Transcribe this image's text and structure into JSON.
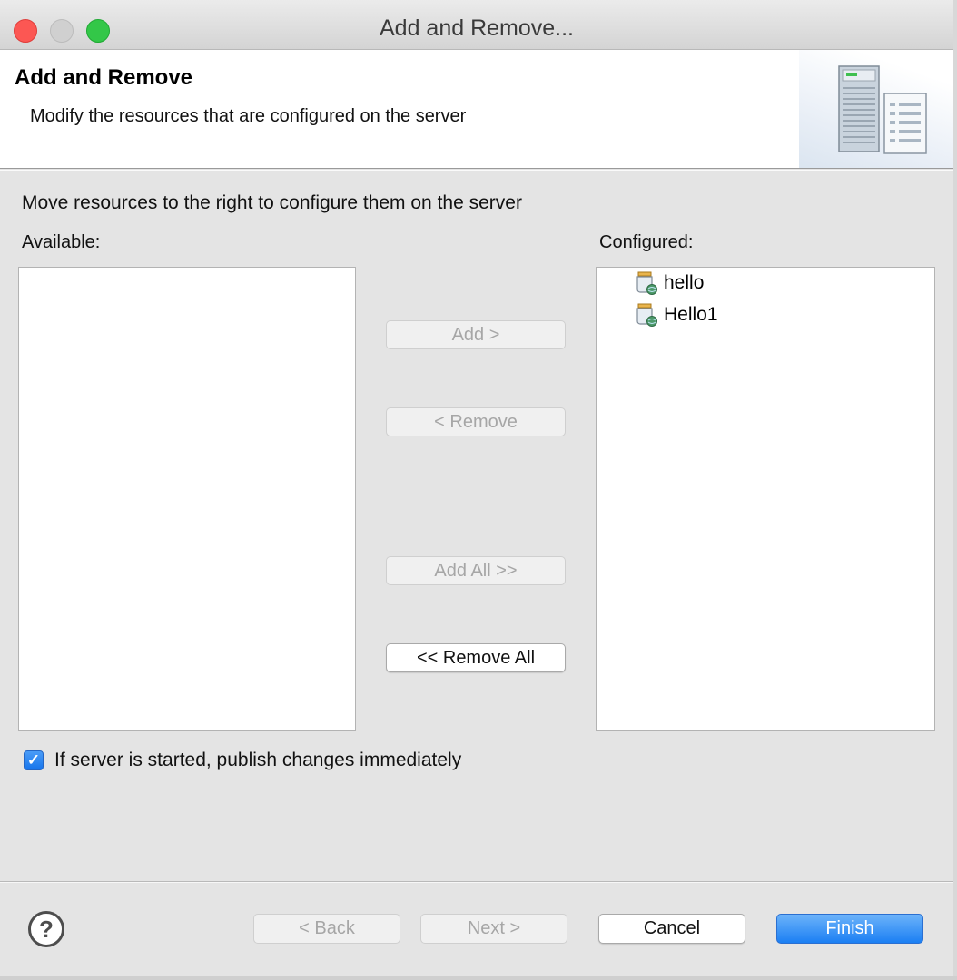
{
  "window": {
    "title": "Add and Remove..."
  },
  "header": {
    "title": "Add and Remove",
    "description": "Modify the resources that are configured on the server",
    "icon": "server-wizard-icon"
  },
  "main": {
    "instruction": "Move resources to the right to configure them on the server",
    "available_label": "Available:",
    "configured_label": "Configured:",
    "available_items": [],
    "configured_items": [
      {
        "label": "hello",
        "icon": "web-project-icon"
      },
      {
        "label": "Hello1",
        "icon": "web-project-icon"
      }
    ],
    "buttons": {
      "add": "Add >",
      "remove": "< Remove",
      "add_all": "Add All >>",
      "remove_all": "<< Remove All"
    },
    "publish_checkbox": {
      "label": "If server is started, publish changes immediately",
      "checked": true
    }
  },
  "footer": {
    "help_icon": "help-icon",
    "back": "< Back",
    "next": "Next >",
    "cancel": "Cancel",
    "finish": "Finish"
  },
  "colors": {
    "primary_button": "#1b7ff3",
    "checkbox": "#1775ec",
    "close": "#fc5753",
    "maximize": "#33c748"
  }
}
